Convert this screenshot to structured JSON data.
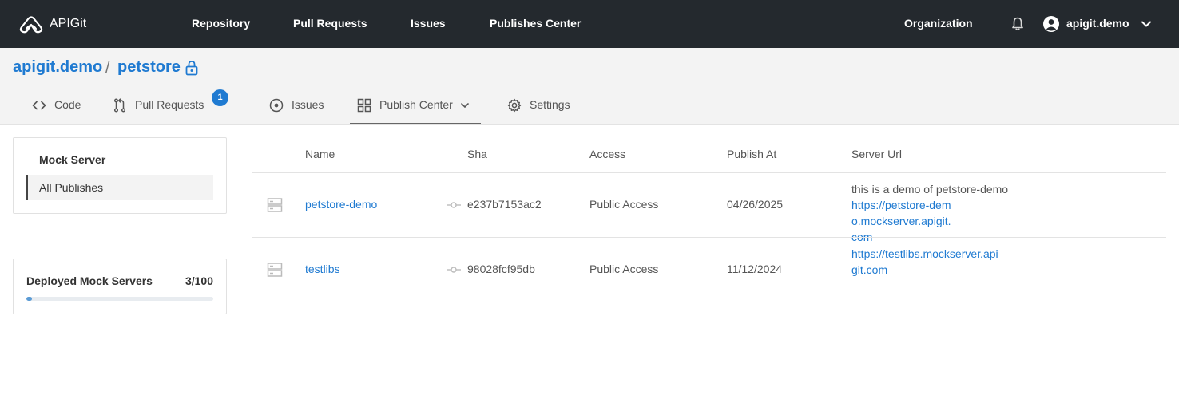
{
  "app": {
    "logo_text": "APIGit"
  },
  "topnav": {
    "items": [
      {
        "label": "Repository"
      },
      {
        "label": "Pull Requests"
      },
      {
        "label": "Issues"
      },
      {
        "label": "Publishes Center"
      }
    ],
    "organization": "Organization",
    "user": "apigit.demo"
  },
  "repo": {
    "owner": "apigit.demo",
    "separator": "/",
    "name": "petstore"
  },
  "tabs": [
    {
      "label": "Code",
      "icon": "code-icon"
    },
    {
      "label": "Pull Requests",
      "icon": "pull-request-icon",
      "badge": "1"
    },
    {
      "label": "Issues",
      "icon": "issue-icon"
    },
    {
      "label": "Publish Center",
      "icon": "grid-icon",
      "active": true
    },
    {
      "label": "Settings",
      "icon": "gear-icon"
    }
  ],
  "sidebar": {
    "title": "Mock Server",
    "items": [
      {
        "label": "All Publishes",
        "selected": true
      }
    ]
  },
  "deployed": {
    "label": "Deployed Mock Servers",
    "count": "3/100",
    "used": 3,
    "limit": 100
  },
  "table": {
    "headers": {
      "name": "Name",
      "sha": "Sha",
      "access": "Access",
      "publish_at": "Publish At",
      "server_url": "Server Url"
    },
    "rows": [
      {
        "name": "petstore-demo",
        "sha": "e237b7153ac2",
        "access": "Public Access",
        "publish_at": "04/26/2025",
        "description": "this is a demo of petstore-demo",
        "url": "https://petstore-demo.mockserver.apigit.com"
      },
      {
        "name": "testlibs",
        "sha": "98028fcf95db",
        "access": "Public Access",
        "publish_at": "11/12/2024",
        "description": "",
        "url": "https://testlibs.mockserver.apigit.com"
      }
    ]
  },
  "colors": {
    "topbar": "#24292e",
    "accent": "#1f7ad1",
    "header_bg": "#f3f3f3"
  }
}
